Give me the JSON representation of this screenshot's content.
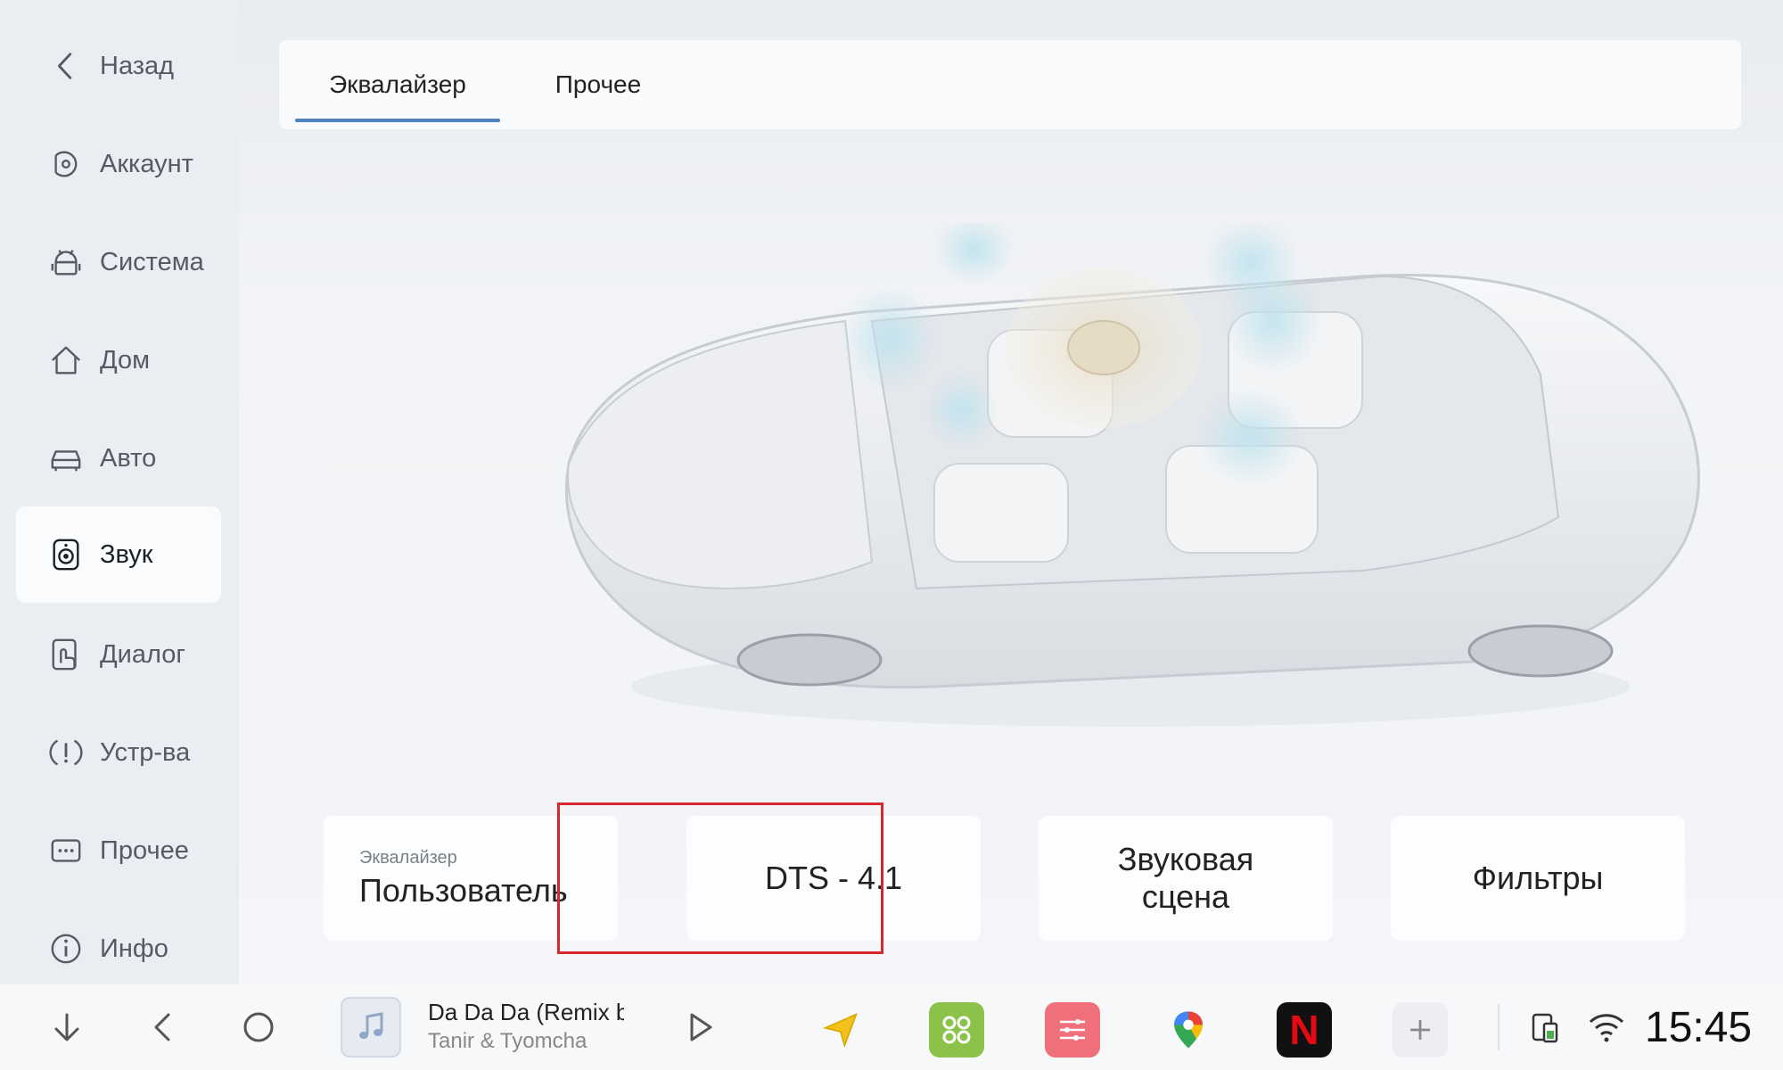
{
  "sidebar": {
    "items": [
      {
        "label": "Назад",
        "icon": "back-chevron-icon"
      },
      {
        "label": "Аккаунт",
        "icon": "account-icon"
      },
      {
        "label": "Система",
        "icon": "android-icon"
      },
      {
        "label": "Дом",
        "icon": "home-icon"
      },
      {
        "label": "Авто",
        "icon": "car-icon"
      },
      {
        "label": "Звук",
        "icon": "speaker-icon",
        "active": true
      },
      {
        "label": "Диалог",
        "icon": "dialog-icon"
      },
      {
        "label": "Устр-ва",
        "icon": "devices-icon"
      },
      {
        "label": "Прочее",
        "icon": "more-icon"
      },
      {
        "label": "Инфо",
        "icon": "info-icon"
      }
    ]
  },
  "tabs": [
    {
      "label": "Эквалайзер",
      "active": true
    },
    {
      "label": "Прочее",
      "active": false
    }
  ],
  "cards": {
    "equalizer": {
      "small": "Эквалайзер",
      "big": "Пользователь"
    },
    "dts": {
      "big": "DTS - 4.1"
    },
    "scene": {
      "line1": "Звуковая",
      "line2": "сцена"
    },
    "filters": {
      "big": "Фильтры"
    }
  },
  "bottombar": {
    "song_title": "Da Da Da (Remix b",
    "song_artist": "Tanir & Tyomcha",
    "clock": "15:45",
    "apps": [
      "navigator-icon",
      "apps-grid-icon",
      "equalizer-app-icon",
      "google-maps-icon",
      "netflix-icon",
      "add-app-icon"
    ],
    "netflix_letter": "N"
  },
  "colors": {
    "accent": "#4d7fc1",
    "highlight": "#d6262e",
    "apps_green": "#8bc34a",
    "eq_pink": "#ef6f7b",
    "netflix_red": "#e50914"
  }
}
